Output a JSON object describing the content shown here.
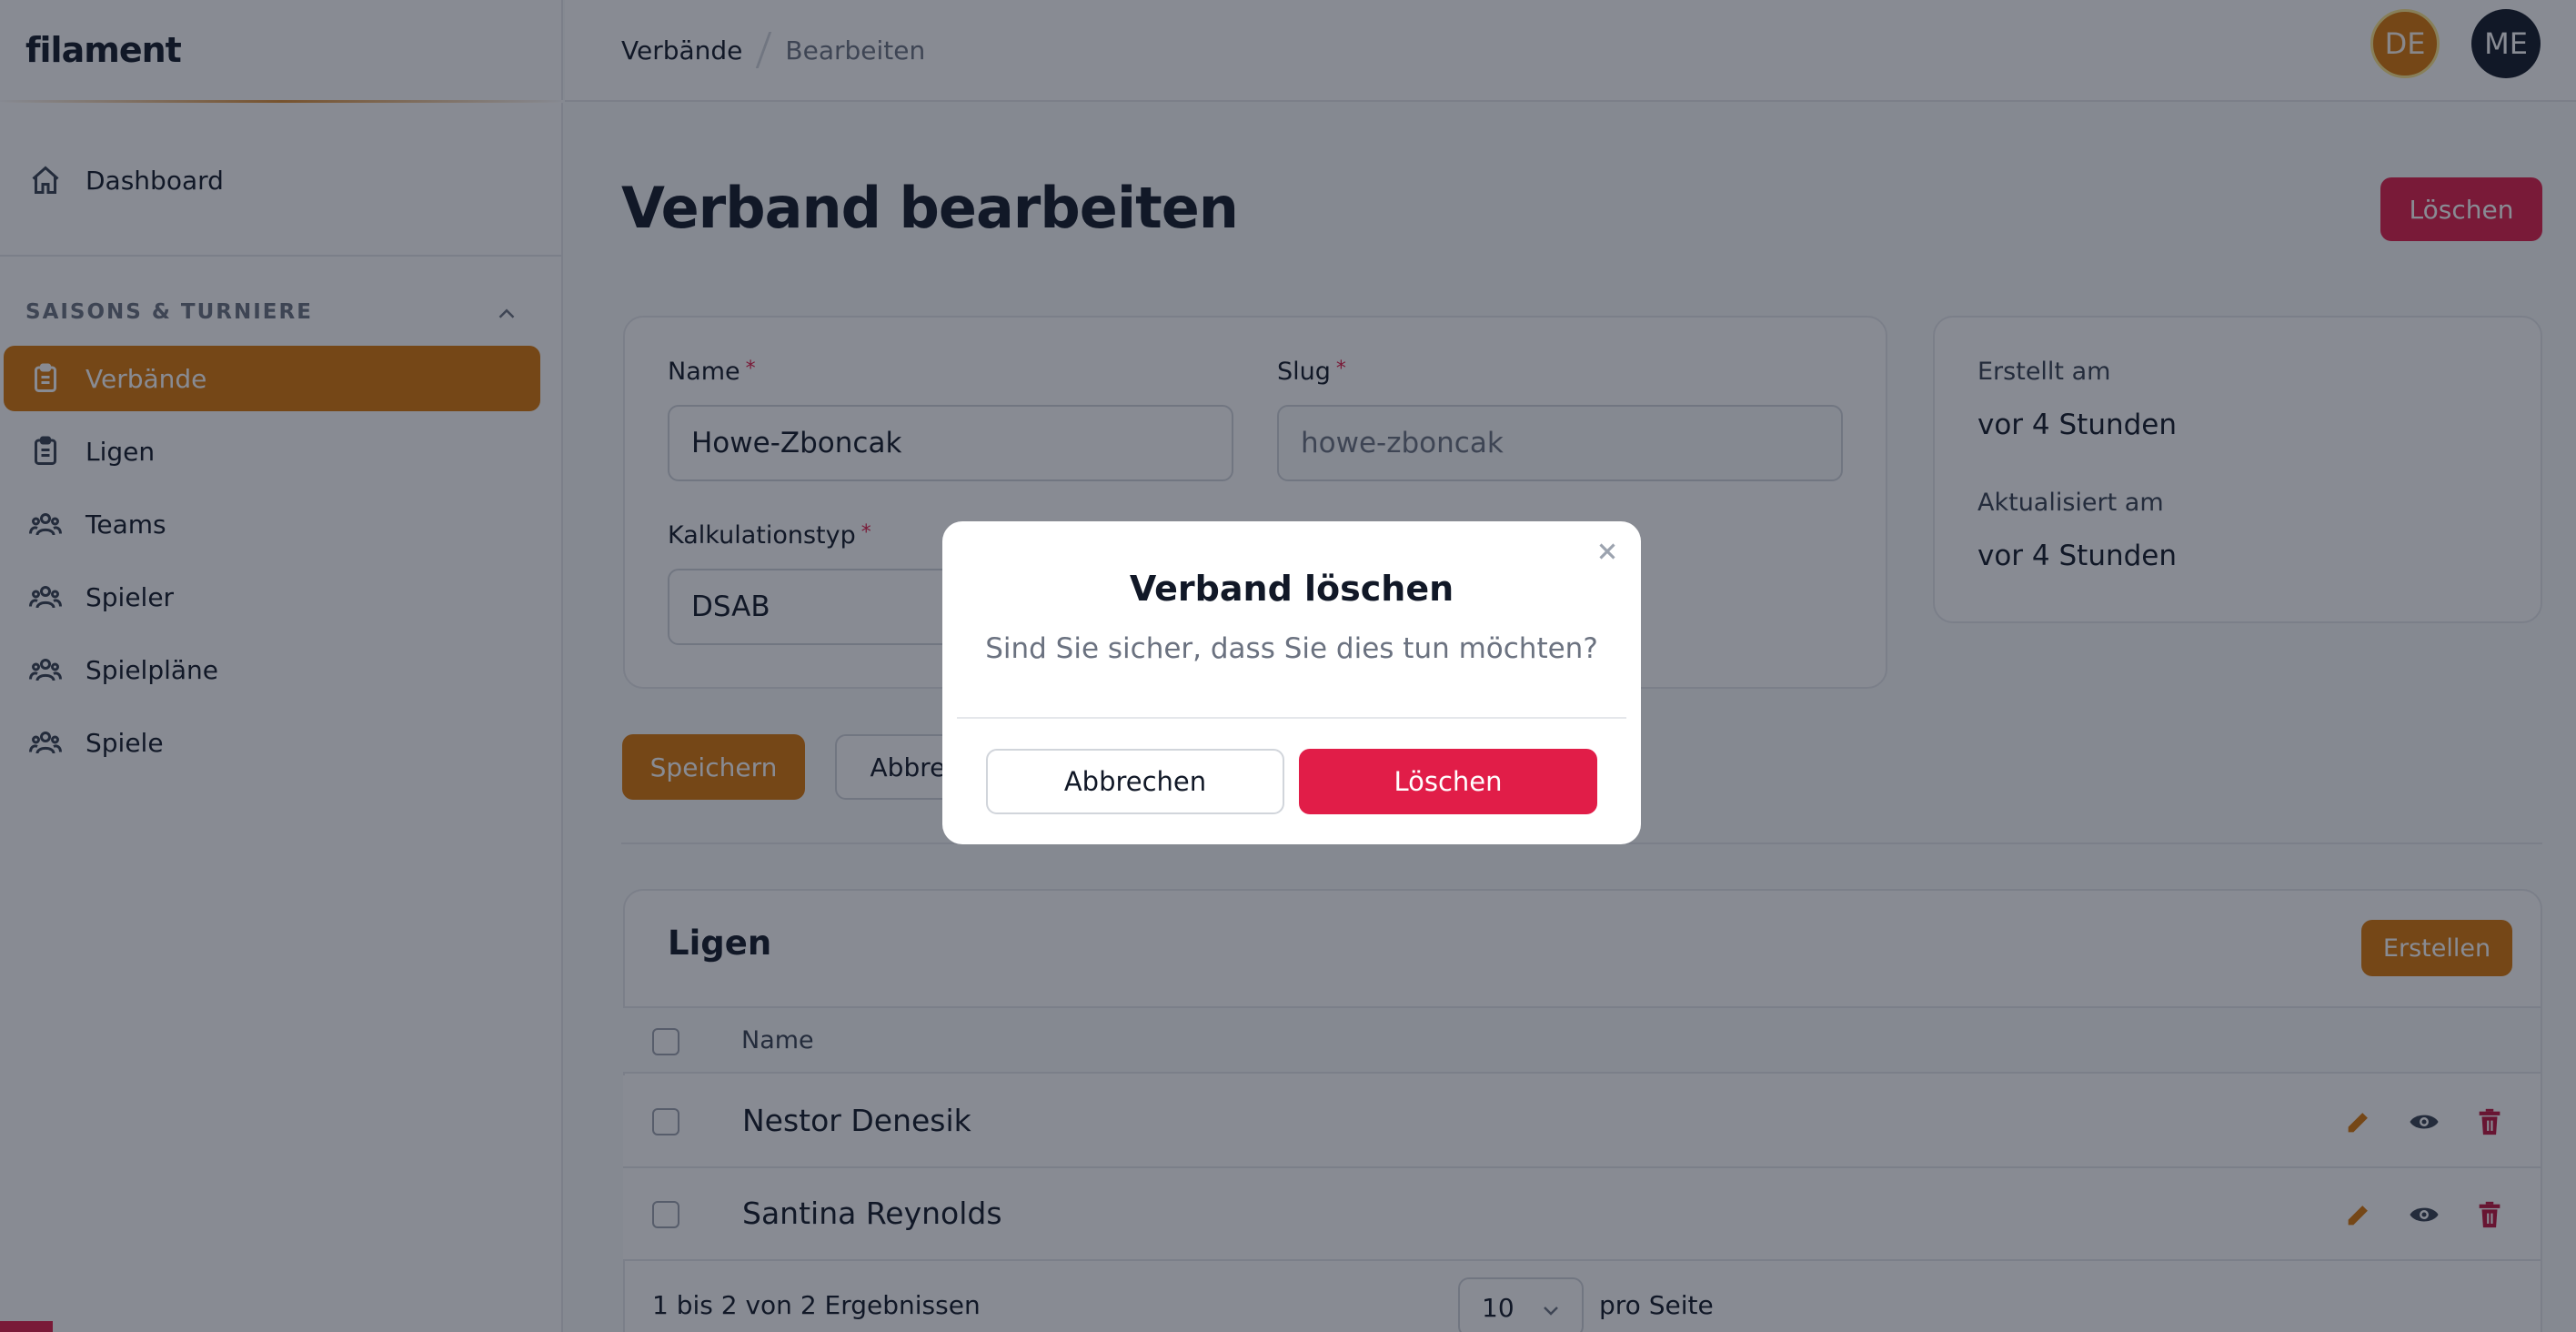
{
  "brand": "filament",
  "sidebar": {
    "items_top": [
      {
        "label": "Dashboard",
        "icon": "home-icon"
      }
    ],
    "group_label": "SAISONS & TURNIERE",
    "items": [
      {
        "label": "Verbände",
        "icon": "clipboard-icon",
        "active": true
      },
      {
        "label": "Ligen",
        "icon": "clipboard-icon"
      },
      {
        "label": "Teams",
        "icon": "users-icon"
      },
      {
        "label": "Spieler",
        "icon": "users-icon"
      },
      {
        "label": "Spielpläne",
        "icon": "users-icon"
      },
      {
        "label": "Spiele",
        "icon": "users-icon"
      }
    ]
  },
  "topbar": {
    "breadcrumbs": [
      "Verbände",
      "Bearbeiten"
    ],
    "avatars": [
      "DE",
      "ME"
    ]
  },
  "main": {
    "title": "Verband bearbeiten",
    "delete_label": "Löschen",
    "form": {
      "name_label": "Name",
      "name_value": "Howe-Zboncak",
      "slug_label": "Slug",
      "slug_value": "howe-zboncak",
      "calc_label": "Kalkulationstyp",
      "calc_value": "DSAB",
      "required_mark": "*"
    },
    "meta": {
      "created_label": "Erstellt am",
      "created_value": "vor 4 Stunden",
      "updated_label": "Aktualisiert am",
      "updated_value": "vor 4 Stunden"
    },
    "save_label": "Speichern",
    "cancel_label": "Abbrechen"
  },
  "table": {
    "title": "Ligen",
    "create_label": "Erstellen",
    "column": "Name",
    "rows": [
      "Nestor Denesik",
      "Santina Reynolds"
    ],
    "footer_text": "1 bis 2 von 2 Ergebnissen",
    "per_page_value": "10",
    "per_page_label": "pro Seite"
  },
  "modal": {
    "title": "Verband löschen",
    "description": "Sind Sie sicher, dass Sie dies tun möchten?",
    "cancel_label": "Abbrechen",
    "confirm_label": "Löschen"
  },
  "colors": {
    "primary": "#d97706",
    "danger": "#e11d48",
    "overlay": "rgba(17,24,39,0.5)"
  }
}
